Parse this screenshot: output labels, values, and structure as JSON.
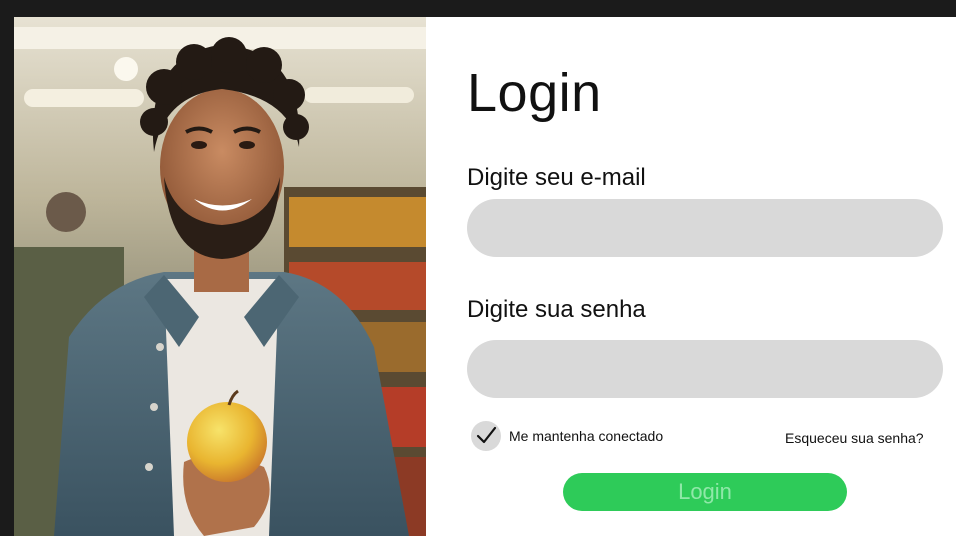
{
  "photo": {
    "description_icon": "smiling-man-holding-apple-image"
  },
  "login": {
    "title": "Login",
    "email_label": "Digite seu e-mail",
    "email_value": "",
    "email_placeholder": "",
    "password_label": "Digite sua senha",
    "password_value": "",
    "password_placeholder": "",
    "remember_label": "Me mantenha conectado",
    "remember_checked": true,
    "forgot_link": "Esqueceu sua senha?",
    "submit_label": "Login"
  },
  "colors": {
    "frame": "#1b1b1b",
    "input_bg": "#d9d9d9",
    "button_bg": "#2ecb59",
    "button_text": "#8fe8a8"
  }
}
